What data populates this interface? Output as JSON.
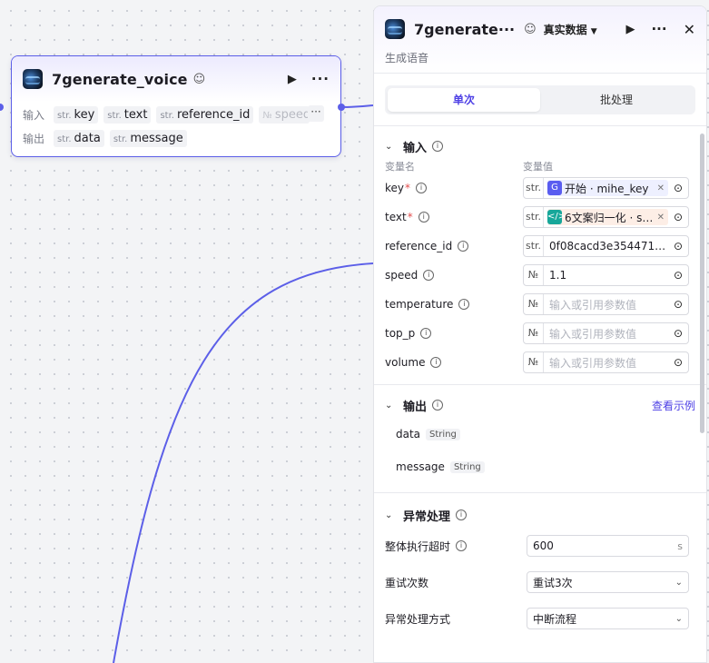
{
  "node": {
    "title": "7generate_voice",
    "input_label": "输入",
    "output_label": "输出",
    "inputs": [
      {
        "type": "str.",
        "name": "key"
      },
      {
        "type": "str.",
        "name": "text"
      },
      {
        "type": "str.",
        "name": "reference_id"
      },
      {
        "type": "№",
        "name": "speed"
      }
    ],
    "outputs": [
      {
        "type": "str.",
        "name": "data"
      },
      {
        "type": "str.",
        "name": "message"
      }
    ],
    "more": "···"
  },
  "panel": {
    "title": "7generate···",
    "mode": "真实数据",
    "description": "生成语音",
    "tabs": [
      "单次",
      "批处理"
    ],
    "input_section": {
      "title": "输入",
      "col_name": "变量名",
      "col_value": "变量值",
      "params": [
        {
          "name": "key",
          "required": "*",
          "type": "str.",
          "chip_text": "开始 · mihe_key"
        },
        {
          "name": "text",
          "required": "*",
          "type": "str.",
          "chip_text": "6文案归一化 · su···"
        },
        {
          "name": "reference_id",
          "required": "",
          "type": "str.",
          "value": "0f08cacd3e354471a···"
        },
        {
          "name": "speed",
          "required": "",
          "type": "№",
          "value": "1.1"
        },
        {
          "name": "temperature",
          "required": "",
          "type": "№",
          "placeholder": "输入或引用参数值"
        },
        {
          "name": "top_p",
          "required": "",
          "type": "№",
          "placeholder": "输入或引用参数值"
        },
        {
          "name": "volume",
          "required": "",
          "type": "№",
          "placeholder": "输入或引用参数值"
        }
      ]
    },
    "output_section": {
      "title": "输出",
      "link": "查看示例",
      "items": [
        {
          "name": "data",
          "type": "String"
        },
        {
          "name": "message",
          "type": "String"
        }
      ]
    },
    "error_section": {
      "title": "异常处理",
      "timeout_label": "整体执行超时",
      "timeout_value": "600",
      "timeout_unit": "s",
      "retry_label": "重试次数",
      "retry_value": "重试3次",
      "method_label": "异常处理方式",
      "method_value": "中断流程"
    }
  },
  "colors": {
    "accent": "#4e40e5",
    "edge": "#5c5fe8"
  }
}
